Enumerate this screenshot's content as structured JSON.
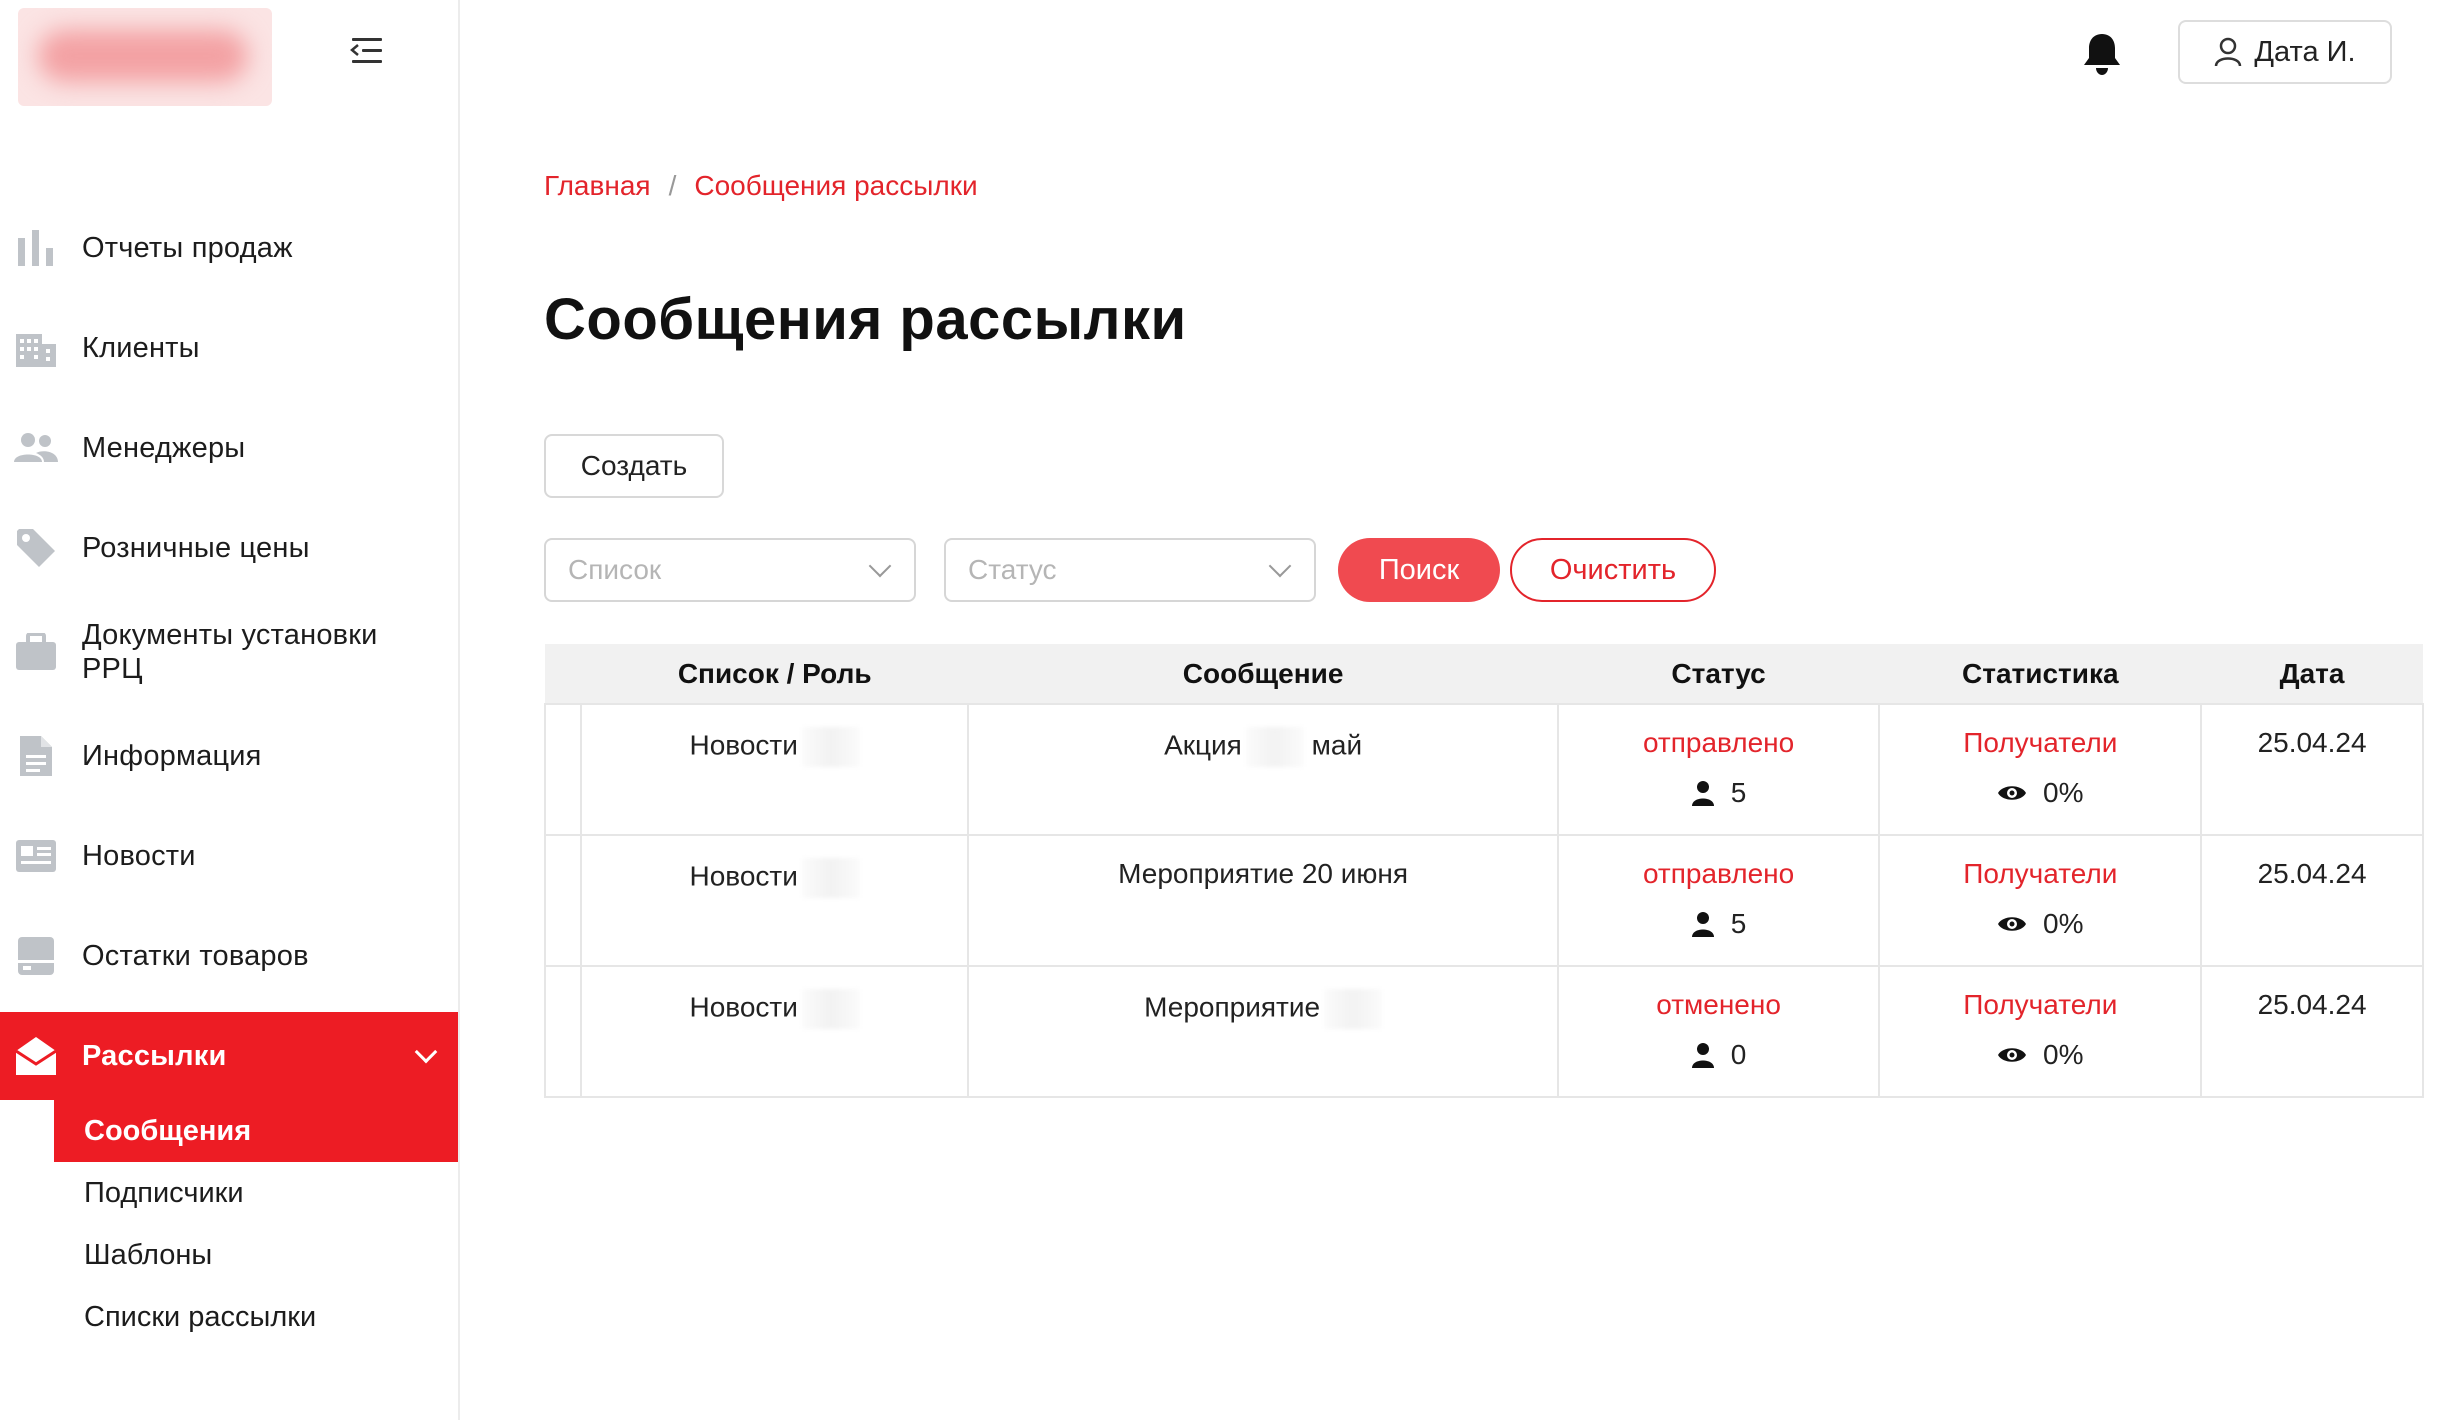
{
  "sidebar": {
    "items": [
      {
        "label": "Отчеты продаж",
        "icon": "bar-chart-icon"
      },
      {
        "label": "Клиенты",
        "icon": "building-icon"
      },
      {
        "label": "Менеджеры",
        "icon": "people-icon"
      },
      {
        "label": "Розничные цены",
        "icon": "tag-icon"
      },
      {
        "label": "Документы установки РРЦ",
        "icon": "briefcase-icon"
      },
      {
        "label": "Информация",
        "icon": "document-icon"
      },
      {
        "label": "Новости",
        "icon": "newspaper-icon"
      },
      {
        "label": "Остатки товаров",
        "icon": "inventory-icon"
      },
      {
        "label": "Рассылки",
        "icon": "envelope-open-icon",
        "active": true
      }
    ],
    "submenu": [
      {
        "label": "Сообщения",
        "active": true
      },
      {
        "label": "Подписчики"
      },
      {
        "label": "Шаблоны"
      },
      {
        "label": "Списки рассылки"
      }
    ]
  },
  "header": {
    "user_label": "Дата И."
  },
  "breadcrumb": {
    "home": "Главная",
    "separator": "/",
    "current": "Сообщения рассылки"
  },
  "page_title": "Сообщения рассылки",
  "toolbar": {
    "create_label": "Создать",
    "list_placeholder": "Список",
    "status_placeholder": "Статус",
    "search_label": "Поиск",
    "clear_label": "Очистить"
  },
  "table": {
    "columns": [
      "Список / Роль",
      "Сообщение",
      "Статус",
      "Статистика",
      "Дата"
    ],
    "rows": [
      {
        "list": "Новости",
        "message": "Акция",
        "message_suffix": "май",
        "status": "отправлено",
        "recipients": "5",
        "stats_link": "Получатели",
        "views": "0%",
        "date": "25.04.24"
      },
      {
        "list": "Новости",
        "message": "Мероприятие 20 июня",
        "message_suffix": "",
        "status": "отправлено",
        "recipients": "5",
        "stats_link": "Получатели",
        "views": "0%",
        "date": "25.04.24"
      },
      {
        "list": "Новости",
        "message": "Мероприятие",
        "message_suffix": "",
        "status": "отменено",
        "recipients": "0",
        "stats_link": "Получатели",
        "views": "0%",
        "date": "25.04.24"
      }
    ]
  },
  "colors": {
    "accent": "#ed1c24",
    "link": "#e3242b",
    "search_button": "#f04a50",
    "icon_grey": "#bfc3c8"
  }
}
